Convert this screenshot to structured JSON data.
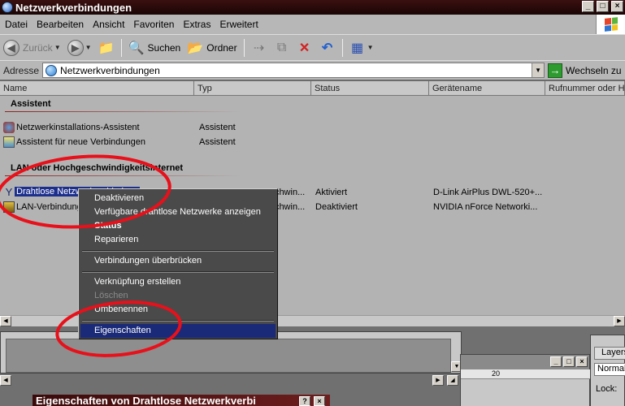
{
  "window": {
    "title": "Netzwerkverbindungen"
  },
  "menubar": {
    "items": [
      "Datei",
      "Bearbeiten",
      "Ansicht",
      "Favoriten",
      "Extras",
      "Erweitert"
    ]
  },
  "toolbar": {
    "back": "Zurück",
    "search": "Suchen",
    "folders": "Ordner"
  },
  "address": {
    "label": "Adresse",
    "value": "Netzwerkverbindungen",
    "go": "Wechseln zu"
  },
  "columns": [
    "Name",
    "Typ",
    "Status",
    "Gerätename",
    "Rufnummer oder Ho"
  ],
  "groups": {
    "assistant": {
      "title": "Assistent",
      "rows": [
        {
          "name": "Netzwerkinstallations-Assistent",
          "type": "Assistent"
        },
        {
          "name": "Assistent für neue Verbindungen",
          "type": "Assistent"
        }
      ]
    },
    "lan": {
      "title": "LAN oder Hochgeschwindigkeitsinternet",
      "rows": [
        {
          "name": "Drahtlose Netzwerkverbindung",
          "type": "LAN oder Hochgeschwin...",
          "status": "Aktiviert",
          "device": "D-Link AirPlus DWL-520+..."
        },
        {
          "name": "LAN-Verbindung",
          "type": "LAN oder Hochgeschwin...",
          "status": "Deaktiviert",
          "device": "NVIDIA nForce Networki..."
        }
      ]
    }
  },
  "context_menu": {
    "items": [
      {
        "label": "Deaktivieren"
      },
      {
        "label": "Verfügbare drahtlose Netzwerke anzeigen"
      },
      {
        "label": "Status"
      },
      {
        "label": "Reparieren"
      },
      {
        "label": "Verbindungen überbrücken"
      },
      {
        "label": "Verknüpfung erstellen"
      },
      {
        "label": "Löschen"
      },
      {
        "label": "Umbenennen"
      },
      {
        "label": "Eigenschaften"
      }
    ]
  },
  "bg_windows": {
    "ruler_mark": "20",
    "layers_tab": "Layers",
    "blend_mode": "Normal",
    "lock_label": "Lock:"
  },
  "dialog": {
    "title": "Eigenschaften von Drahtlose Netzwerkverbi"
  },
  "colors": {
    "selection": "#1c2f8c",
    "annotation": "#e8101a",
    "titlebar": "#2a0a0a"
  }
}
